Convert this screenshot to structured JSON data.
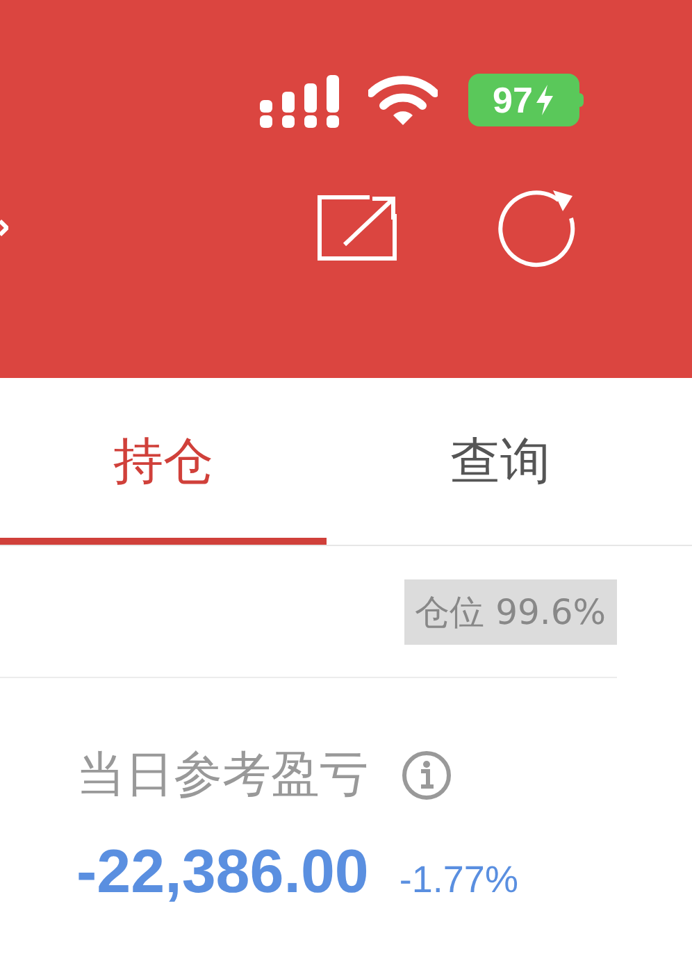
{
  "status_bar": {
    "battery": "97"
  },
  "tabs": [
    {
      "label": "持仓",
      "selected": true
    },
    {
      "label": "查询",
      "selected": false
    }
  ],
  "position": {
    "text": "仓位 99.6%"
  },
  "pnl": {
    "label": "当日参考盈亏",
    "value": "-22,386.00",
    "percent": "-1.77%"
  }
}
